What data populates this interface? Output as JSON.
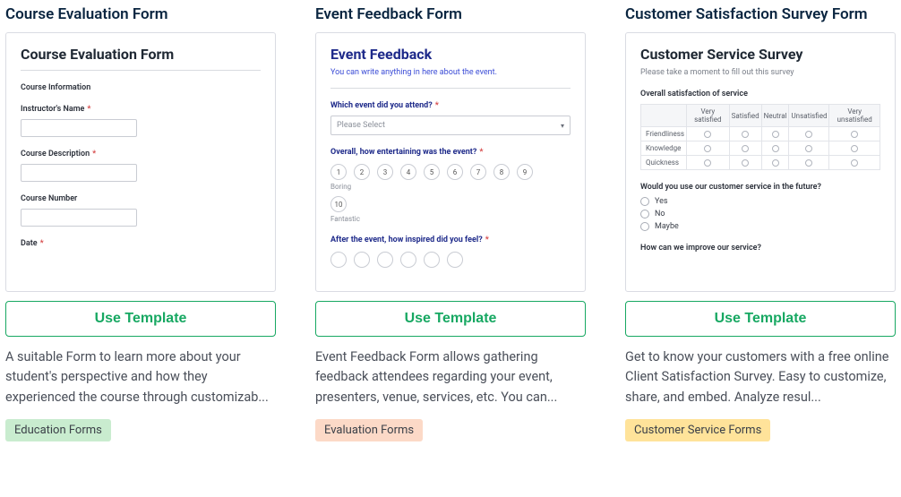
{
  "cards": [
    {
      "title": "Course Evaluation Form",
      "use_label": "Use Template",
      "description": "A suitable Form to learn more about your student's perspective and how they experienced the course through customizab...",
      "tag": "Education Forms",
      "tag_class": "tag-green",
      "preview": {
        "heading": "Course Evaluation Form",
        "section": "Course Information",
        "fields": [
          {
            "label": "Instructor's Name",
            "required": true
          },
          {
            "label": "Course Description",
            "required": true
          },
          {
            "label": "Course Number",
            "required": false
          },
          {
            "label": "Date",
            "required": true
          }
        ]
      }
    },
    {
      "title": "Event Feedback Form",
      "use_label": "Use Template",
      "description": "Event Feedback Form allows gathering feedback attendees regarding your event, presenters, venue, services, etc. You can...",
      "tag": "Evaluation Forms",
      "tag_class": "tag-orange",
      "preview": {
        "heading": "Event Feedback",
        "subheading": "You can write anything in here about the event.",
        "q1": "Which event did you attend?",
        "select_placeholder": "Please Select",
        "q2": "Overall, how entertaining was the event?",
        "scale": [
          "1",
          "2",
          "3",
          "4",
          "5",
          "6",
          "7",
          "8",
          "9",
          "10"
        ],
        "low_label": "Boring",
        "high_label": "Fantastic",
        "q3": "After the event, how inspired did you feel?"
      }
    },
    {
      "title": "Customer Satisfaction Survey Form",
      "use_label": "Use Template",
      "description": "Get to know your customers with a free online Client Satisfaction Survey. Easy to customize, share, and embed. Analyze resul...",
      "tag": "Customer Service Forms",
      "tag_class": "tag-yellow",
      "preview": {
        "heading": "Customer Service Survey",
        "subheading": "Please take a moment to fill out this survey",
        "q1": "Overall satisfaction of service",
        "matrix_cols": [
          "Very satisfied",
          "Satisfied",
          "Neutral",
          "Unsatisfied",
          "Very unsatisfied"
        ],
        "matrix_rows": [
          "Friendliness",
          "Knowledge",
          "Quickness"
        ],
        "q2": "Would you use our customer service in the future?",
        "options": [
          "Yes",
          "No",
          "Maybe"
        ],
        "q3": "How can we improve our service?"
      }
    }
  ]
}
